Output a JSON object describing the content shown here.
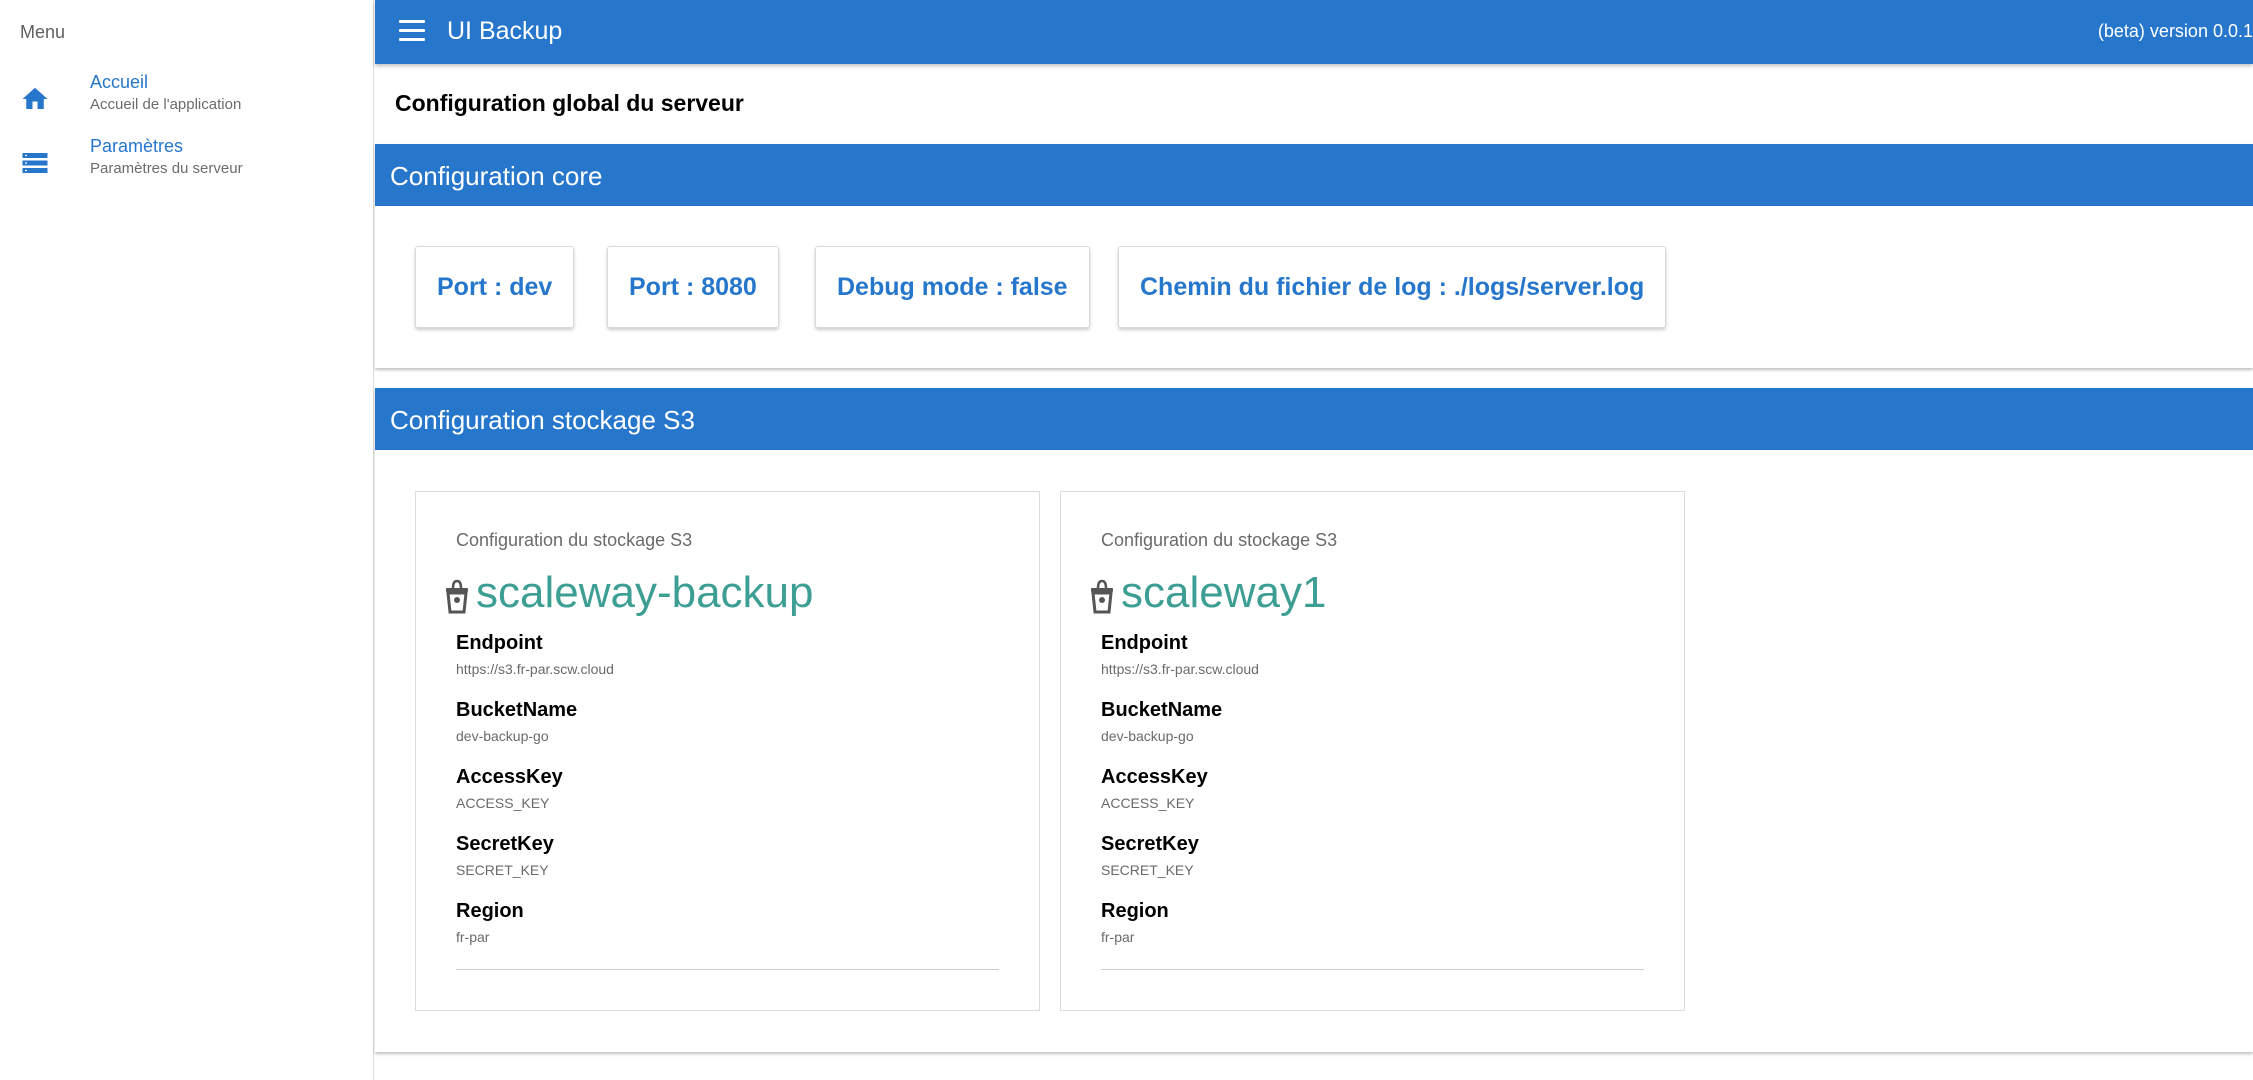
{
  "sidebar": {
    "title": "Menu",
    "items": [
      {
        "label": "Accueil",
        "subtitle": "Accueil de l'application",
        "icon": "home-icon"
      },
      {
        "label": "Paramètres",
        "subtitle": "Paramètres du serveur",
        "icon": "list-icon"
      }
    ]
  },
  "topbar": {
    "title": "UI Backup",
    "version": "(beta) version 0.0.1",
    "icon": "hamburger-menu-icon"
  },
  "page": {
    "title": "Configuration global du serveur"
  },
  "core": {
    "header": "Configuration core",
    "chips": [
      "Port : dev",
      "Port : 8080",
      "Debug mode : false",
      "Chemin du fichier de log : ./logs/server.log"
    ]
  },
  "s3": {
    "header": "Configuration stockage S3",
    "cards": [
      {
        "caption": "Configuration du stockage S3",
        "name": "scaleway-backup",
        "fields": [
          {
            "label": "Endpoint",
            "value": "https://s3.fr-par.scw.cloud"
          },
          {
            "label": "BucketName",
            "value": "dev-backup-go"
          },
          {
            "label": "AccessKey",
            "value": "ACCESS_KEY"
          },
          {
            "label": "SecretKey",
            "value": "SECRET_KEY"
          },
          {
            "label": "Region",
            "value": "fr-par"
          }
        ]
      },
      {
        "caption": "Configuration du stockage S3",
        "name": "scaleway1",
        "fields": [
          {
            "label": "Endpoint",
            "value": "https://s3.fr-par.scw.cloud"
          },
          {
            "label": "BucketName",
            "value": "dev-backup-go"
          },
          {
            "label": "AccessKey",
            "value": "ACCESS_KEY"
          },
          {
            "label": "SecretKey",
            "value": "SECRET_KEY"
          },
          {
            "label": "Region",
            "value": "fr-par"
          }
        ]
      }
    ]
  },
  "colors": {
    "primary": "#2677cc",
    "accent": "#3d9e93",
    "muted_text": "#6a6a6a"
  }
}
